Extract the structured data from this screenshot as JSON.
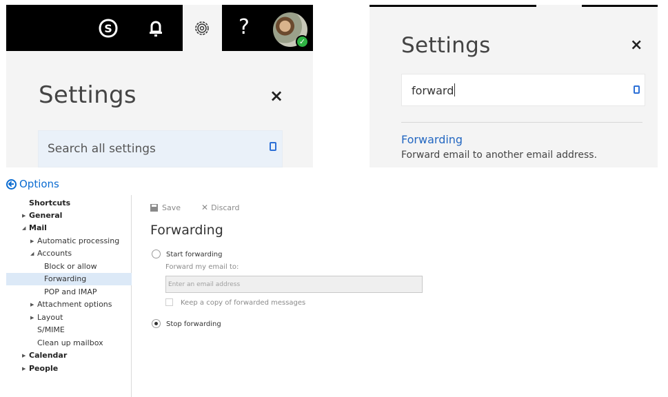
{
  "panel_a": {
    "settings_title": "Settings",
    "close_label": "×",
    "search_placeholder": "Search all settings",
    "help_label": "?",
    "avatar_badge": "✓"
  },
  "panel_b": {
    "settings_title": "Settings",
    "close_label": "×",
    "search_value": "forward",
    "result_title": "Forwarding",
    "result_description": "Forward email to another email address."
  },
  "options": {
    "header": "Options",
    "nav": [
      {
        "label": "Shortcuts"
      },
      {
        "label": "General",
        "arrow": "▶"
      },
      {
        "label": "Mail",
        "arrow": "◢"
      },
      {
        "label": "Automatic processing",
        "arrow": "▶"
      },
      {
        "label": "Accounts",
        "arrow": "◢"
      },
      {
        "label": "Block or allow"
      },
      {
        "label": "Forwarding"
      },
      {
        "label": "POP and IMAP"
      },
      {
        "label": "Attachment options",
        "arrow": "▶"
      },
      {
        "label": "Layout",
        "arrow": "▶"
      },
      {
        "label": "S/MIME"
      },
      {
        "label": "Clean up mailbox"
      },
      {
        "label": "Calendar",
        "arrow": "▶"
      },
      {
        "label": "People",
        "arrow": "▶"
      }
    ],
    "toolbar": {
      "save_label": "Save",
      "discard_label": "Discard",
      "discard_icon": "✕"
    },
    "page_title": "Forwarding",
    "start_forwarding_label": "Start forwarding",
    "forward_to_label": "Forward my email to:",
    "email_placeholder": "Enter an email address",
    "keep_copy_label": "Keep a copy of forwarded messages",
    "stop_forwarding_label": "Stop forwarding",
    "selected_option": "stop_forwarding"
  },
  "colors": {
    "accent": "#0a6bd1",
    "link": "#2367c1",
    "nav_selected": "#dce9f7",
    "presence": "#2fb344"
  }
}
